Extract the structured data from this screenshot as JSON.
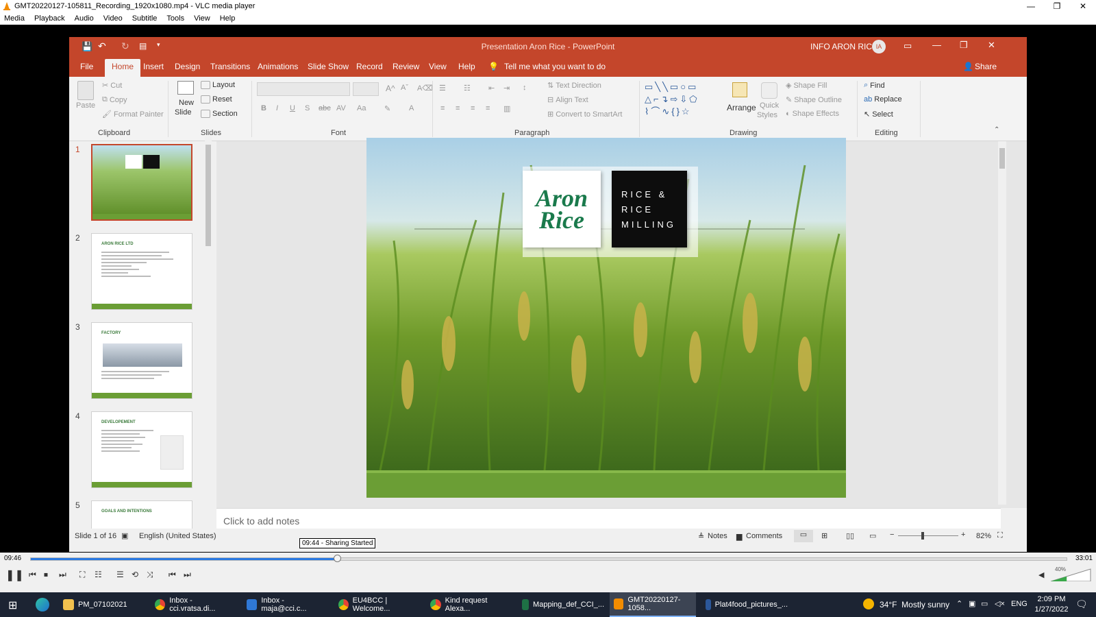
{
  "vlc": {
    "window_title": "GMT20220127-105811_Recording_1920x1080.mp4 - VLC media player",
    "menu": [
      "Media",
      "Playback",
      "Audio",
      "Video",
      "Subtitle",
      "Tools",
      "View",
      "Help"
    ],
    "time_elapsed": "09:46",
    "time_total": "33:01",
    "progress": 0.296,
    "marker_tooltip": "09:44 - Sharing Started",
    "volume": "40%"
  },
  "powerpoint": {
    "title": "Presentation Aron Rice - PowerPoint",
    "user": "INFO ARON RICE",
    "user_initials": "IA",
    "tabs": [
      "File",
      "Home",
      "Insert",
      "Design",
      "Transitions",
      "Animations",
      "Slide Show",
      "Record",
      "Review",
      "View",
      "Help"
    ],
    "active_tab": "Home",
    "tell_me": "Tell me what you want to do",
    "share": "Share",
    "ribbon": {
      "clipboard": {
        "label": "Clipboard",
        "paste": "Paste",
        "cut": "Cut",
        "copy": "Copy",
        "format_painter": "Format Painter"
      },
      "slides": {
        "label": "Slides",
        "new_slide_1": "New",
        "new_slide_2": "Slide",
        "layout": "Layout",
        "reset": "Reset",
        "section": "Section"
      },
      "font": {
        "label": "Font"
      },
      "paragraph": {
        "label": "Paragraph",
        "text_direction": "Text Direction",
        "align_text": "Align Text",
        "convert_smartart": "Convert to SmartArt"
      },
      "drawing": {
        "label": "Drawing",
        "arrange": "Arrange",
        "quick_styles_1": "Quick",
        "quick_styles_2": "Styles",
        "shape_fill": "Shape Fill",
        "shape_outline": "Shape Outline",
        "shape_effects": "Shape Effects"
      },
      "editing": {
        "label": "Editing",
        "find": "Find",
        "replace": "Replace",
        "select": "Select"
      }
    },
    "thumbnails": [
      {
        "num": "1",
        "title": ""
      },
      {
        "num": "2",
        "title": "ARON RICE LTD"
      },
      {
        "num": "3",
        "title": "FACTORY"
      },
      {
        "num": "4",
        "title": "DEVELOPEMENT"
      },
      {
        "num": "5",
        "title": "GOALS AND INTENTIONS"
      }
    ],
    "slide": {
      "logo_line1": "Aron",
      "logo_line2": "Rice",
      "tag_line1": "RICE &",
      "tag_line2": "RICE",
      "tag_line3": "MILLING"
    },
    "notes_placeholder": "Click to add notes",
    "status": {
      "slide_count": "Slide 1 of 16",
      "language": "English (United States)",
      "notes": "Notes",
      "comments": "Comments",
      "zoom": "82%"
    }
  },
  "taskbar": {
    "items": [
      "PM_07102021",
      "Inbox - cci.vratsa.di...",
      "Inbox - maja@cci.c...",
      "EU4BCC | Welcome...",
      "Kind request Alexa...",
      "Mapping_def_CCI_...",
      "GMT20220127-1058...",
      "Plat4food_pictures_..."
    ],
    "weather": "34°F  Mostly sunny",
    "lang": "ENG",
    "time": "2:09 PM",
    "date": "1/27/2022"
  },
  "colors": {
    "ppt_accent": "#c4462b",
    "slide_green": "#6b9e35",
    "vlc_progress": "#2a7ae2"
  }
}
